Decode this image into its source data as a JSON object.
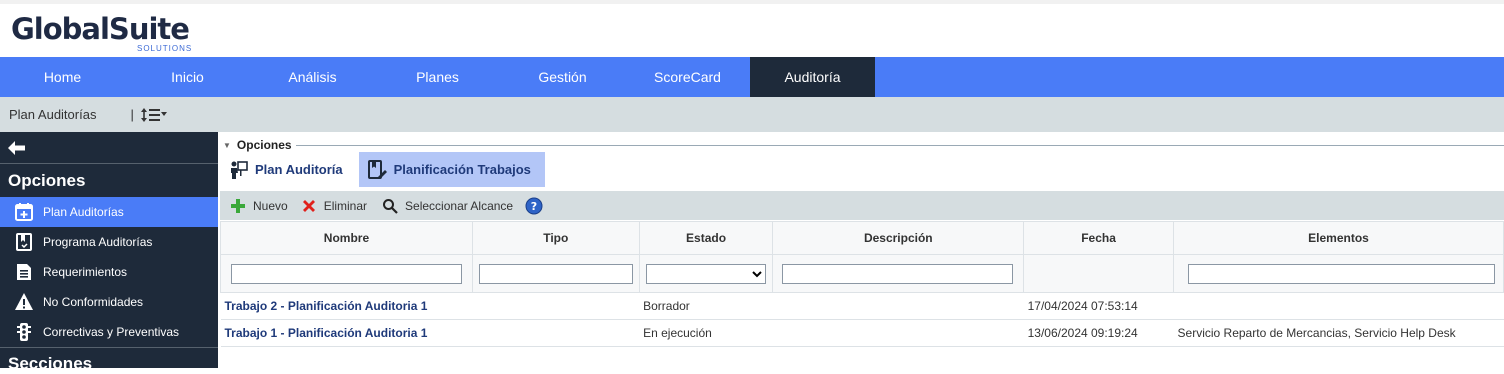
{
  "logo": {
    "main": "GlobalSuite",
    "sub": "SOLUTIONS"
  },
  "nav": [
    {
      "label": "Home",
      "active": false
    },
    {
      "label": "Inicio",
      "active": false
    },
    {
      "label": "Análisis",
      "active": false
    },
    {
      "label": "Planes",
      "active": false
    },
    {
      "label": "Gestión",
      "active": false
    },
    {
      "label": "ScoreCard",
      "active": false
    },
    {
      "label": "Auditoría",
      "active": true
    }
  ],
  "subbar": {
    "crumb": "Plan Auditorías",
    "separator": "|",
    "menu_icon": "list-sort-icon"
  },
  "sidebar": {
    "heading": "Opciones",
    "items": [
      {
        "label": "Plan Auditorías",
        "icon": "calendar-plus-icon",
        "active": true
      },
      {
        "label": "Programa Auditorías",
        "icon": "bookmark-book-icon",
        "active": false
      },
      {
        "label": "Requerimientos",
        "icon": "document-icon",
        "active": false
      },
      {
        "label": "No Conformidades",
        "icon": "warning-icon",
        "active": false
      },
      {
        "label": "Correctivas y Preventivas",
        "icon": "traffic-light-icon",
        "active": false
      }
    ],
    "section_heading": "Secciones"
  },
  "content": {
    "legend": "Opciones",
    "tabs": [
      {
        "label": "Plan Auditoría",
        "icon": "presenter-icon",
        "active": false
      },
      {
        "label": "Planificación Trabajos",
        "icon": "book-edit-icon",
        "active": true
      }
    ],
    "toolbar": {
      "new_label": "Nuevo",
      "delete_label": "Eliminar",
      "scope_label": "Seleccionar Alcance",
      "help_icon": "help-icon"
    },
    "table": {
      "columns": [
        "Nombre",
        "Tipo",
        "Estado",
        "Descripción",
        "Fecha",
        "Elementos"
      ],
      "rows": [
        {
          "nombre": "Trabajo 2 - Planificación Auditoria 1",
          "tipo": "",
          "estado": "Borrador",
          "descripcion": "",
          "fecha": "17/04/2024 07:53:14",
          "elementos": ""
        },
        {
          "nombre": "Trabajo 1 - Planificación Auditoria 1",
          "tipo": "",
          "estado": "En ejecución",
          "descripcion": "",
          "fecha": "13/06/2024 09:19:24",
          "elementos": "Servicio Reparto de Mercancias, Servicio Help Desk"
        }
      ]
    }
  },
  "colors": {
    "nav": "#4a7cf7",
    "nav_active": "#1e2a3a",
    "sidebar": "#1e2a3a",
    "accent": "#4a7cf7",
    "link": "#1f3a7a"
  }
}
